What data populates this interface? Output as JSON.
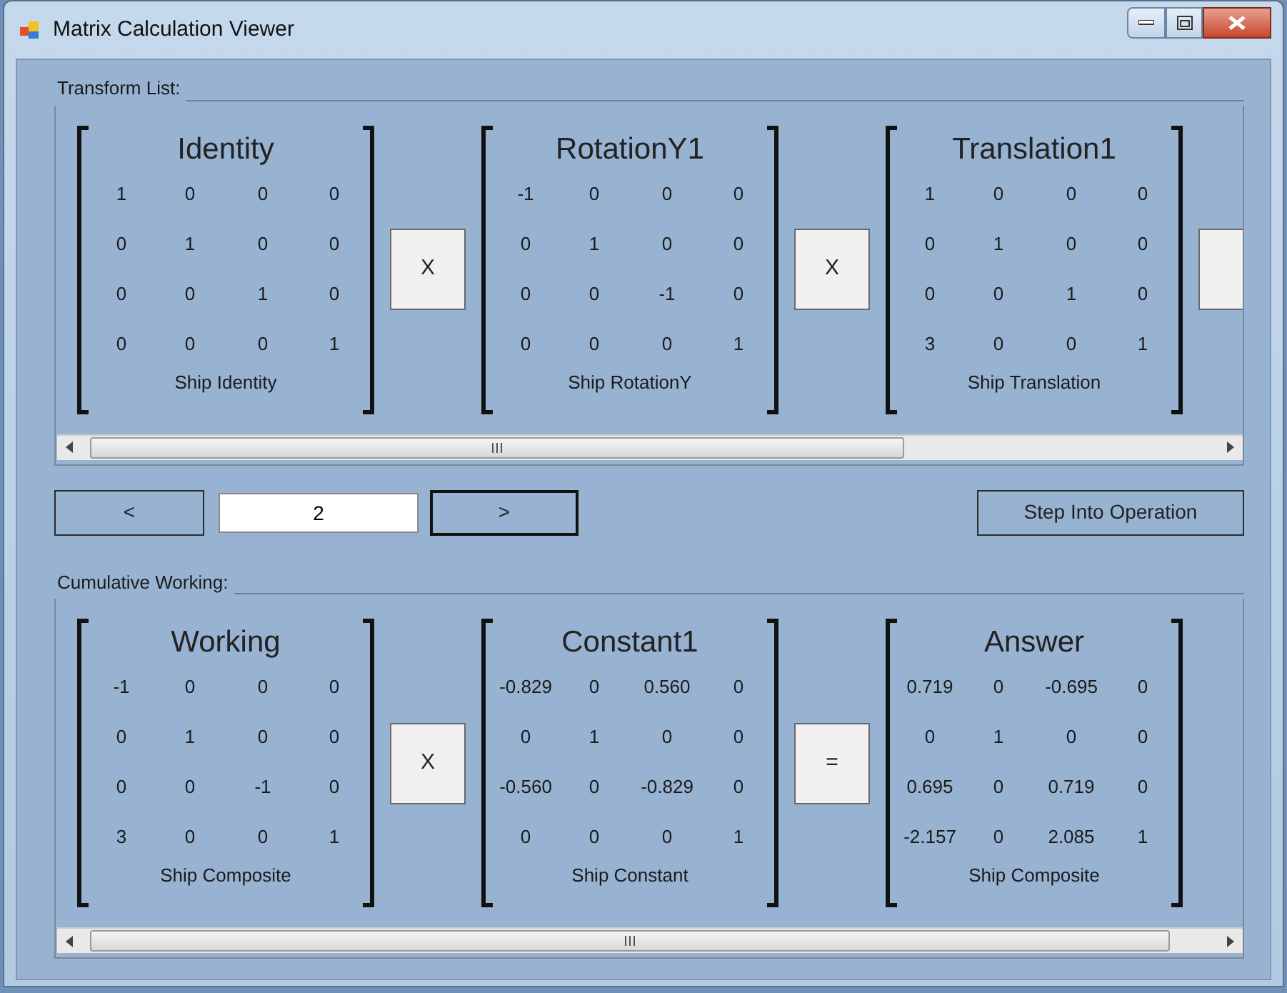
{
  "window": {
    "title": "Matrix Calculation Viewer"
  },
  "transform_list": {
    "label": "Transform List:",
    "items": [
      {
        "kind": "matrix",
        "title": "Identity",
        "rows": [
          [
            "1",
            "0",
            "0",
            "0"
          ],
          [
            "0",
            "1",
            "0",
            "0"
          ],
          [
            "0",
            "0",
            "1",
            "0"
          ],
          [
            "0",
            "0",
            "0",
            "1"
          ]
        ],
        "caption": "Ship Identity"
      },
      {
        "kind": "operator",
        "label": "X"
      },
      {
        "kind": "matrix",
        "title": "RotationY1",
        "rows": [
          [
            "-1",
            "0",
            "0",
            "0"
          ],
          [
            "0",
            "1",
            "0",
            "0"
          ],
          [
            "0",
            "0",
            "-1",
            "0"
          ],
          [
            "0",
            "0",
            "0",
            "1"
          ]
        ],
        "caption": "Ship RotationY"
      },
      {
        "kind": "operator",
        "label": "X"
      },
      {
        "kind": "matrix",
        "title": "Translation1",
        "rows": [
          [
            "1",
            "0",
            "0",
            "0"
          ],
          [
            "0",
            "1",
            "0",
            "0"
          ],
          [
            "0",
            "0",
            "1",
            "0"
          ],
          [
            "3",
            "0",
            "0",
            "1"
          ]
        ],
        "caption": "Ship Translation"
      },
      {
        "kind": "operator_cut"
      }
    ]
  },
  "navigation": {
    "prev": {
      "label": "<",
      "focused": false
    },
    "index": "2",
    "next": {
      "label": ">",
      "focused": true
    },
    "step": {
      "label": "Step Into Operation",
      "focused": false
    }
  },
  "cumulative_working": {
    "label": "Cumulative Working:",
    "items": [
      {
        "kind": "matrix",
        "title": "Working",
        "rows": [
          [
            "-1",
            "0",
            "0",
            "0"
          ],
          [
            "0",
            "1",
            "0",
            "0"
          ],
          [
            "0",
            "0",
            "-1",
            "0"
          ],
          [
            "3",
            "0",
            "0",
            "1"
          ]
        ],
        "caption": "Ship Composite"
      },
      {
        "kind": "operator",
        "label": "X"
      },
      {
        "kind": "matrix",
        "title": "Constant1",
        "rows": [
          [
            "-0.829",
            "0",
            "0.560",
            "0"
          ],
          [
            "0",
            "1",
            "0",
            "0"
          ],
          [
            "-0.560",
            "0",
            "-0.829",
            "0"
          ],
          [
            "0",
            "0",
            "0",
            "1"
          ]
        ],
        "caption": "Ship Constant"
      },
      {
        "kind": "operator",
        "label": "="
      },
      {
        "kind": "matrix",
        "title": "Answer",
        "rows": [
          [
            "0.719",
            "0",
            "-0.695",
            "0"
          ],
          [
            "0",
            "1",
            "0",
            "0"
          ],
          [
            "0.695",
            "0",
            "0.719",
            "0"
          ],
          [
            "-2.157",
            "0",
            "2.085",
            "1"
          ]
        ],
        "caption": "Ship Composite"
      }
    ]
  }
}
